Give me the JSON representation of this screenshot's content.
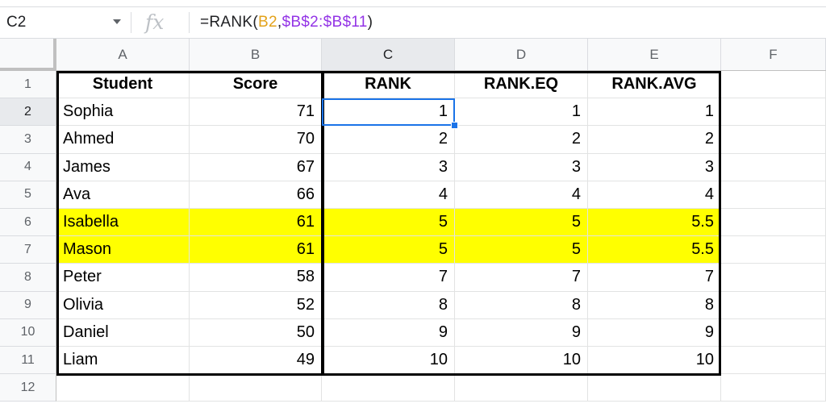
{
  "formula_bar": {
    "cell_ref": "C2",
    "fx_label": "fx",
    "formula_prefix": "=RANK(",
    "formula_arg1": "B2",
    "formula_comma": ",",
    "formula_arg2": "$B$2:$B$11",
    "formula_suffix": ")"
  },
  "columns": [
    "A",
    "B",
    "C",
    "D",
    "E",
    "F"
  ],
  "rows": [
    "1",
    "2",
    "3",
    "4",
    "5",
    "6",
    "7",
    "8",
    "9",
    "10",
    "11",
    "12"
  ],
  "headers": [
    "Student",
    "Score",
    "RANK",
    "RANK.EQ",
    "RANK.AVG"
  ],
  "data": [
    [
      "Sophia",
      "71",
      "1",
      "1",
      "1"
    ],
    [
      "Ahmed",
      "70",
      "2",
      "2",
      "2"
    ],
    [
      "James",
      "67",
      "3",
      "3",
      "3"
    ],
    [
      "Ava",
      "66",
      "4",
      "4",
      "4"
    ],
    [
      "Isabella",
      "61",
      "5",
      "5",
      "5.5"
    ],
    [
      "Mason",
      "61",
      "5",
      "5",
      "5.5"
    ],
    [
      "Peter",
      "58",
      "7",
      "7",
      "7"
    ],
    [
      "Olivia",
      "52",
      "8",
      "8",
      "8"
    ],
    [
      "Daniel",
      "50",
      "9",
      "9",
      "9"
    ],
    [
      "Liam",
      "49",
      "10",
      "10",
      "10"
    ]
  ],
  "highlight_color": "#ffff00",
  "selection_color": "#1a73e8",
  "selected_cell": "C2"
}
